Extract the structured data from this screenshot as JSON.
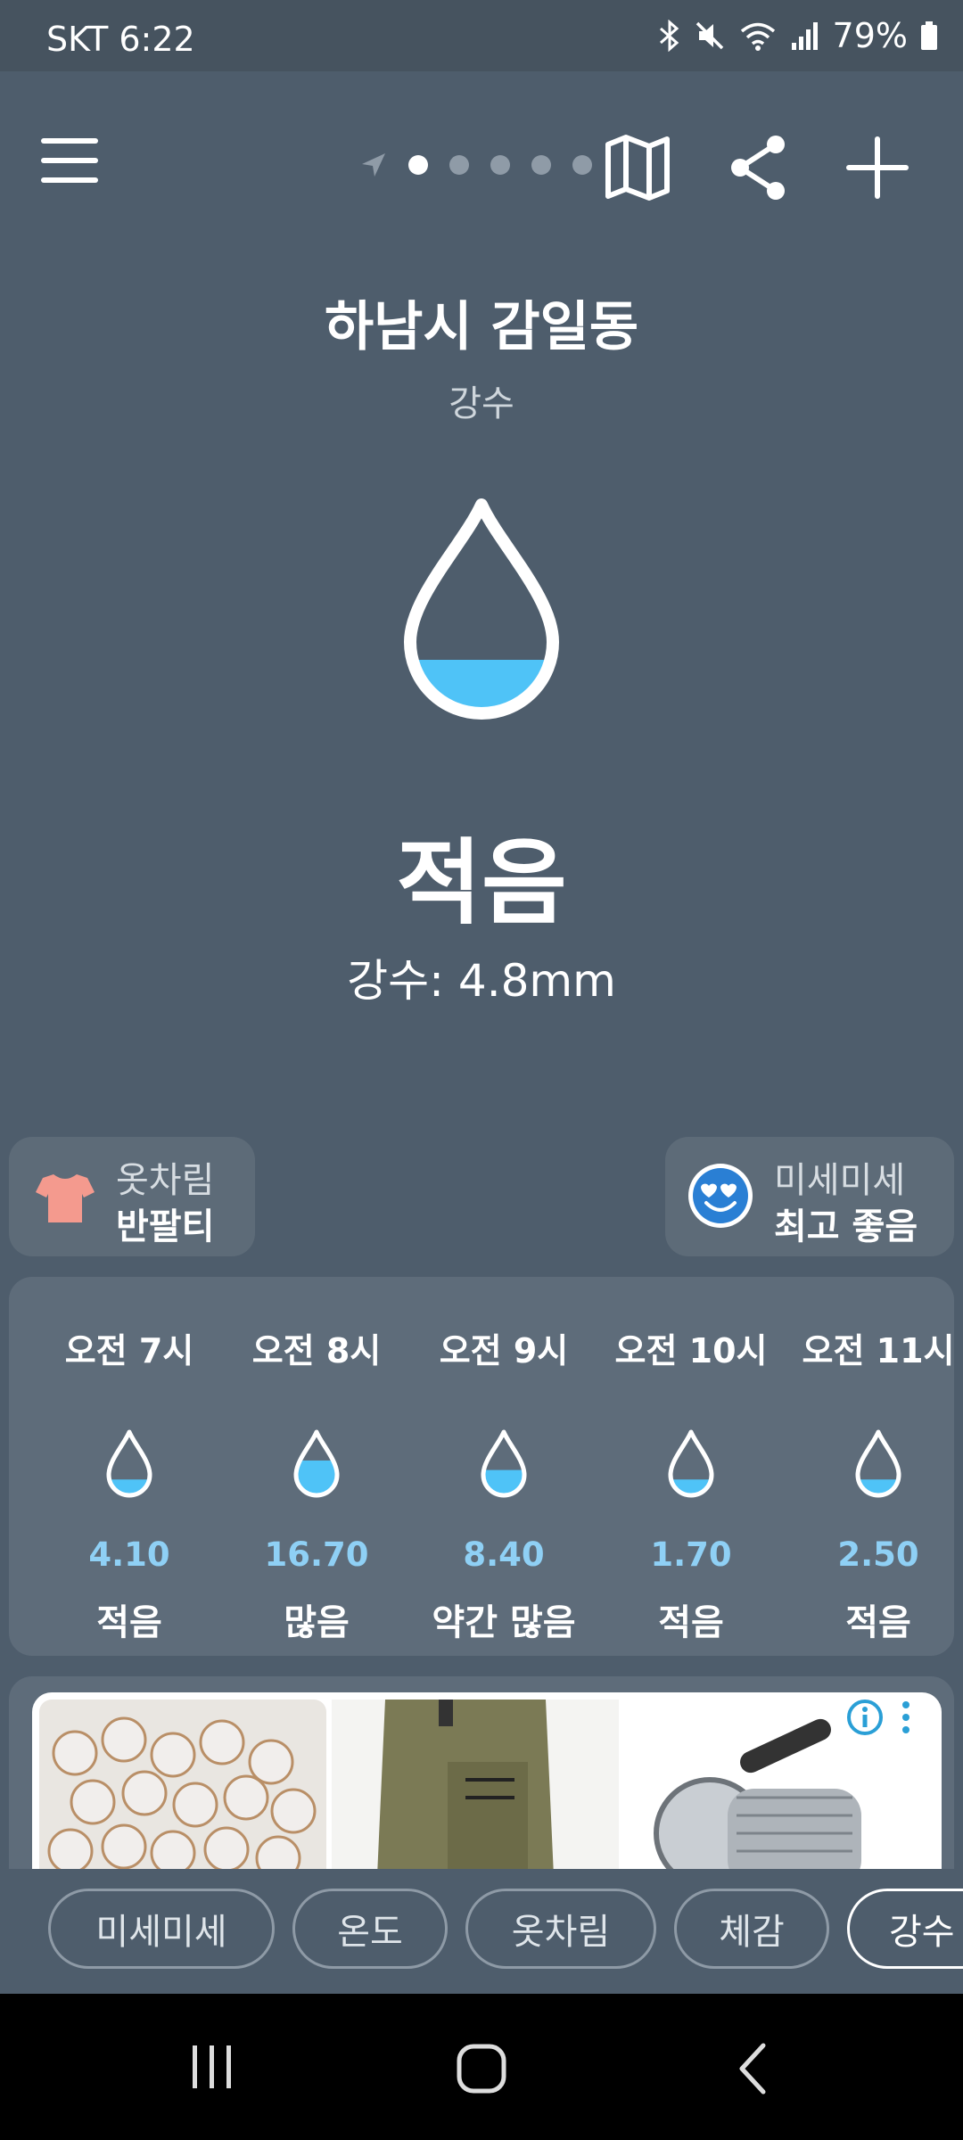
{
  "status_bar": {
    "carrier_time": "SKT 6:22",
    "battery": "79%",
    "icons": [
      "bluetooth-icon",
      "mute-icon",
      "wifi-icon",
      "signal-icon",
      "battery-icon"
    ]
  },
  "toolbar": {
    "icons": [
      "menu-icon",
      "location-arrow-icon",
      "map-icon",
      "share-icon",
      "add-icon"
    ],
    "pages": 5,
    "active_page": 0
  },
  "header": {
    "location": "하남시 감일동",
    "category": "강수"
  },
  "current": {
    "level": "적음",
    "precipitation": "강수: 4.8mm",
    "drop_fill_fraction": 0.2
  },
  "chips": {
    "clothing": {
      "label": "옷차림",
      "value": "반팔티"
    },
    "dust": {
      "label": "미세미세",
      "value": "최고 좋음"
    }
  },
  "hourly": [
    {
      "time": "오전 7시",
      "amount": "4.10",
      "level": "적음",
      "fill": 0.25
    },
    {
      "time": "오전 8시",
      "amount": "16.70",
      "level": "많음",
      "fill": 0.55
    },
    {
      "time": "오전 9시",
      "amount": "8.40",
      "level": "약간 많음",
      "fill": 0.4
    },
    {
      "time": "오전 10시",
      "amount": "1.70",
      "level": "적음",
      "fill": 0.25
    },
    {
      "time": "오전 11시",
      "amount": "2.50",
      "level": "적음",
      "fill": 0.25
    }
  ],
  "ad": {
    "icons": [
      "info-icon",
      "more-icon"
    ],
    "images": [
      "beads-image",
      "cargo-pants-image",
      "winch-image"
    ]
  },
  "tabs": [
    "미세미세",
    "온도",
    "옷차림",
    "체감",
    "강수"
  ],
  "active_tab": "강수",
  "colors": {
    "background": "#4e5d6c",
    "card": "#5e6c7a",
    "water": "#4fc3f7",
    "amount_text": "#8fd0f5"
  }
}
